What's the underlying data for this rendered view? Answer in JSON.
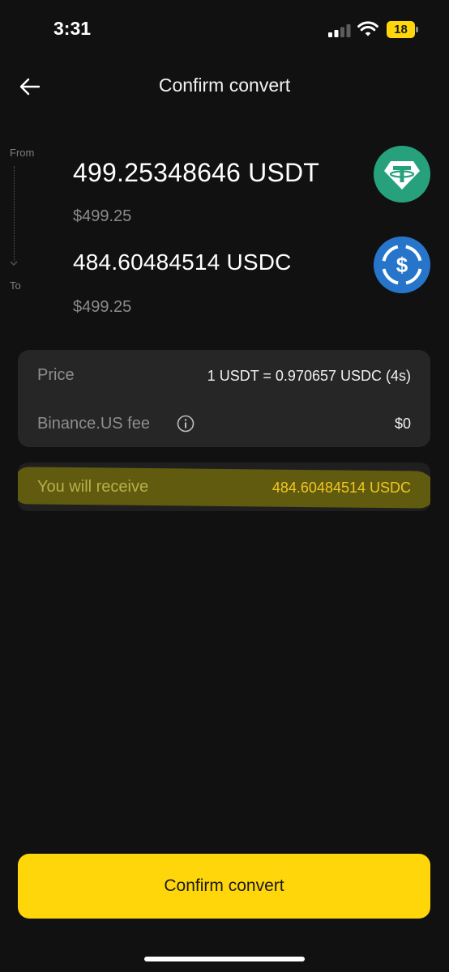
{
  "status_bar": {
    "time": "3:31",
    "battery": "18",
    "icons": [
      "signal-icon",
      "wifi-icon",
      "battery-icon"
    ]
  },
  "header": {
    "title": "Confirm convert",
    "back_icon": "arrow-left-icon"
  },
  "conversion": {
    "from_label": "From",
    "to_label": "To",
    "from": {
      "amount": "499.25348646 USDT",
      "fiat": "$499.25",
      "icon": "tether-icon",
      "color": "#26a17b"
    },
    "to": {
      "amount": "484.60484514 USDC",
      "fiat": "$499.25",
      "icon": "usdc-icon",
      "color": "#2775ca"
    }
  },
  "details": {
    "price_label": "Price",
    "price_value": "1 USDT = 0.970657 USDC (4s)",
    "fee_label": "Binance.US fee",
    "fee_icon": "info-icon",
    "fee_value": "$0"
  },
  "receive": {
    "label": "You will receive",
    "value": "484.60484514 USDC",
    "value_color": "#f3c623"
  },
  "actions": {
    "confirm_label": "Confirm convert",
    "confirm_color": "#ffd60a"
  }
}
